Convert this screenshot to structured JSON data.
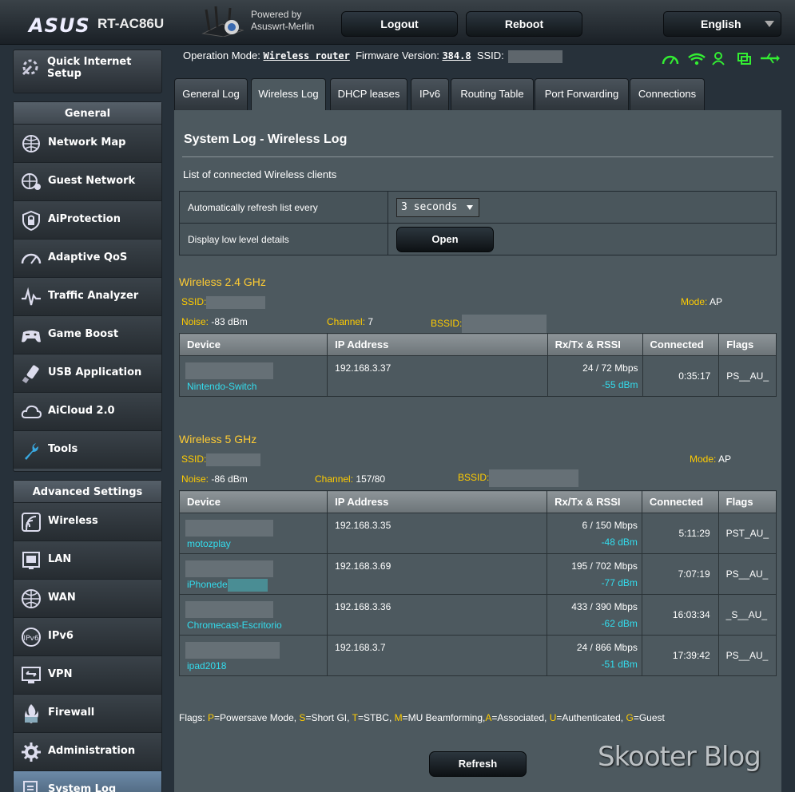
{
  "header": {
    "brand": "ASUS",
    "model": "RT-AC86U",
    "powered_line1": "Powered by",
    "powered_line2": "Asuswrt-Merlin",
    "logout_label": "Logout",
    "reboot_label": "Reboot",
    "language": "English"
  },
  "sidebar": {
    "quick_setup": "Quick Internet Setup",
    "general_title": "General",
    "general_items": [
      {
        "label": "Network Map",
        "icon": "network-map-icon"
      },
      {
        "label": "Guest Network",
        "icon": "guest-network-icon"
      },
      {
        "label": "AiProtection",
        "icon": "aiprotection-icon"
      },
      {
        "label": "Adaptive QoS",
        "icon": "qos-gauge-icon"
      },
      {
        "label": "Traffic Analyzer",
        "icon": "traffic-analyzer-icon"
      },
      {
        "label": "Game Boost",
        "icon": "gamepad-icon"
      },
      {
        "label": "USB Application",
        "icon": "usb-icon"
      },
      {
        "label": "AiCloud 2.0",
        "icon": "cloud-icon"
      },
      {
        "label": "Tools",
        "icon": "wrench-icon"
      }
    ],
    "advanced_title": "Advanced Settings",
    "advanced_items": [
      {
        "label": "Wireless",
        "icon": "wireless-icon"
      },
      {
        "label": "LAN",
        "icon": "lan-icon"
      },
      {
        "label": "WAN",
        "icon": "wan-globe-icon"
      },
      {
        "label": "IPv6",
        "icon": "ipv6-icon"
      },
      {
        "label": "VPN",
        "icon": "vpn-icon"
      },
      {
        "label": "Firewall",
        "icon": "firewall-icon"
      },
      {
        "label": "Administration",
        "icon": "gear-icon"
      },
      {
        "label": "System Log",
        "icon": "system-log-icon"
      }
    ]
  },
  "status": {
    "op_mode_label": "Operation Mode:",
    "op_mode_value": "Wireless router",
    "fw_label": "Firmware Version:",
    "fw_value": "384.8",
    "ssid_label": "SSID:"
  },
  "tabs": [
    "General Log",
    "Wireless Log",
    "DHCP leases",
    "IPv6",
    "Routing Table",
    "Port Forwarding",
    "Connections"
  ],
  "active_tab": 1,
  "page": {
    "title": "System Log - Wireless Log",
    "subtitle": "List of connected Wireless clients",
    "refresh_label": "Automatically refresh list every",
    "refresh_value": "3 seconds",
    "lowlevel_label": "Display low level details",
    "open_label": "Open",
    "refresh_button": "Refresh"
  },
  "bands": [
    {
      "title": "Wireless 2.4 GHz",
      "ssid_label": "SSID:",
      "mode_label": "Mode:",
      "mode_value": "AP",
      "noise_label": "Noise:",
      "noise_value": "-83 dBm",
      "channel_label": "Channel:",
      "channel_value": "7",
      "bssid_label": "BSSID:",
      "clients": [
        {
          "name": "Nintendo-Switch",
          "ip": "192.168.3.37",
          "rate": "24 / 72 Mbps",
          "rssi": "-55 dBm",
          "connected": "0:35:17",
          "flags": "PS__AU_"
        }
      ]
    },
    {
      "title": "Wireless 5 GHz",
      "ssid_label": "SSID:",
      "mode_label": "Mode:",
      "mode_value": "AP",
      "noise_label": "Noise:",
      "noise_value": "-86 dBm",
      "channel_label": "Channel:",
      "channel_value": "157/80",
      "bssid_label": "BSSID:",
      "clients": [
        {
          "name": "motozplay",
          "ip": "192.168.3.35",
          "rate": "6 / 150 Mbps",
          "rssi": "-48 dBm",
          "connected": "5:11:29",
          "flags": "PST_AU_"
        },
        {
          "name": "iPhonede",
          "ip": "192.168.3.69",
          "rate": "195 / 702 Mbps",
          "rssi": "-77 dBm",
          "connected": "7:07:19",
          "flags": "PS__AU_"
        },
        {
          "name": "Chromecast-Escritorio",
          "ip": "192.168.3.36",
          "rate": "433 / 390 Mbps",
          "rssi": "-62 dBm",
          "connected": "16:03:34",
          "flags": "_S__AU_"
        },
        {
          "name": "ipad2018",
          "ip": "192.168.3.7",
          "rate": "24 / 866 Mbps",
          "rssi": "-51 dBm",
          "connected": "17:39:42",
          "flags": "PS__AU_"
        }
      ]
    }
  ],
  "columns": [
    "Device",
    "IP Address",
    "Rx/Tx & RSSI",
    "Connected",
    "Flags"
  ],
  "flags_legend": {
    "prefix": "Flags: ",
    "items": [
      {
        "k": "P",
        "v": "=Powersave Mode, "
      },
      {
        "k": "S",
        "v": "=Short GI, "
      },
      {
        "k": "T",
        "v": "=STBC, "
      },
      {
        "k": "M",
        "v": "=MU Beamforming,"
      },
      {
        "k": "A",
        "v": "=Associated, "
      },
      {
        "k": "U",
        "v": "=Authenticated, "
      },
      {
        "k": "G",
        "v": "=Guest"
      }
    ]
  },
  "watermark": "Skooter Blog",
  "colors": {
    "accent_yellow": "#ffcc00",
    "client_cyan": "#33ddee",
    "status_green": "#33ee33"
  }
}
